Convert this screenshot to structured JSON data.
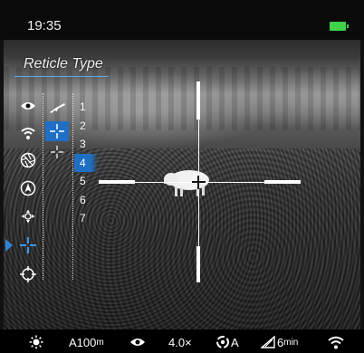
{
  "status_bar": {
    "time": "19:35",
    "battery_icon": "battery-full-icon",
    "battery_color": "#3fd24a"
  },
  "menu": {
    "title": "Reticle Type",
    "left_icons": [
      {
        "name": "eye-icon",
        "active": false
      },
      {
        "name": "wifi-icon",
        "active": false
      },
      {
        "name": "aperture-icon",
        "active": false
      },
      {
        "name": "compass-icon",
        "active": false
      },
      {
        "name": "joystick-icon",
        "active": false
      },
      {
        "name": "reticle-icon",
        "active": true
      },
      {
        "name": "crosshair-target-icon",
        "active": false
      }
    ],
    "reticle_thumbnails": [
      {
        "name": "rifle-icon",
        "selected": false
      },
      {
        "name": "reticle-cross-icon",
        "selected": true
      },
      {
        "name": "reticle-cross-small-icon",
        "selected": false
      }
    ],
    "reticle_numbers": [
      "1",
      "2",
      "3",
      "4",
      "5",
      "6",
      "7"
    ],
    "selected_number": "4",
    "accent_color": "#1f6fc4"
  },
  "bottom_bar": {
    "brightness_icon": "sun-icon",
    "range": "A100",
    "range_unit": "m",
    "eye_icon": "eye-icon",
    "zoom": "4.0×",
    "calibration_icon": "auto-calibration-icon",
    "calibration_mode": "A",
    "timer_icon": "timer-icon",
    "timer_value": "6",
    "timer_unit": "min",
    "wifi_icon": "wifi-icon"
  }
}
